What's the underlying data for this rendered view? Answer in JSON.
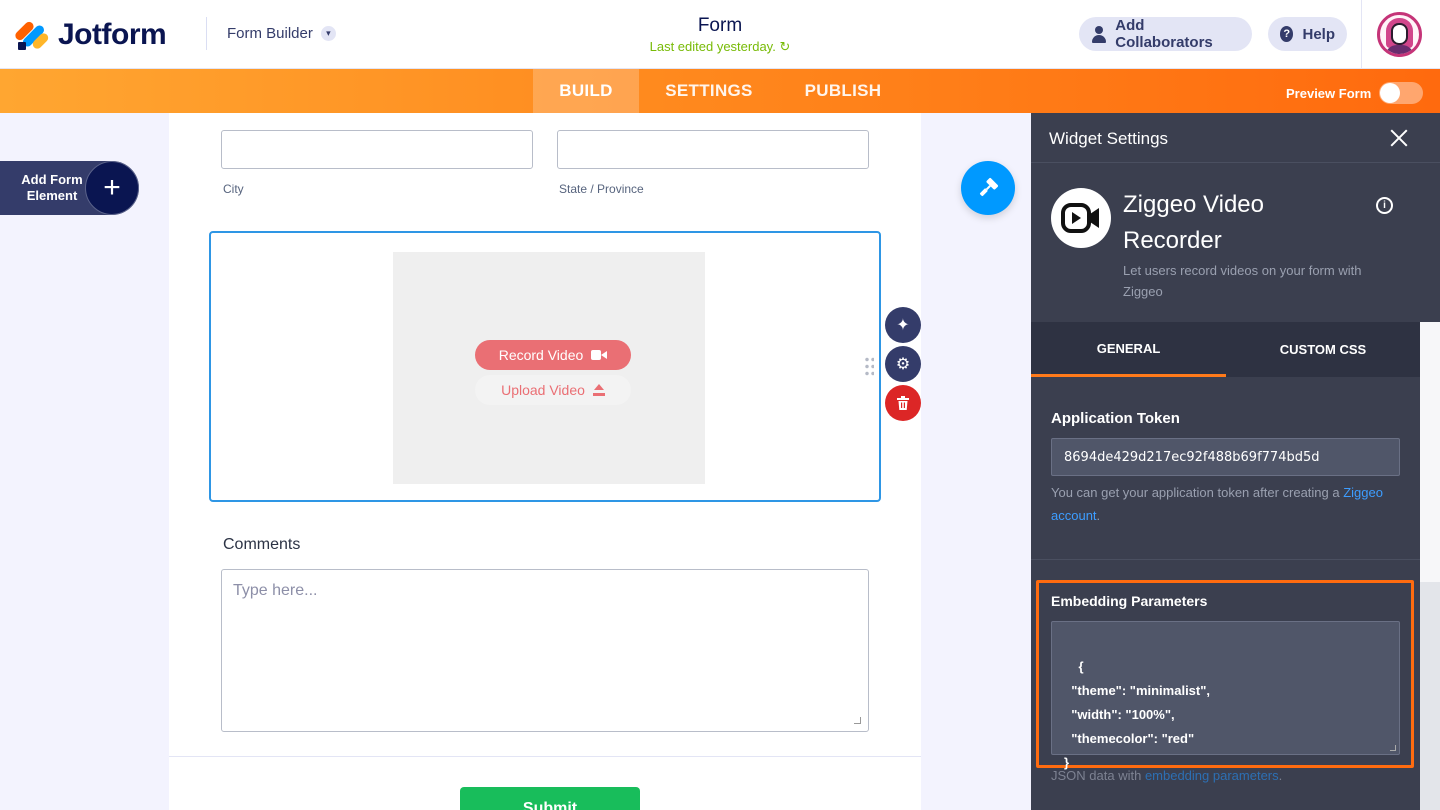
{
  "header": {
    "logo_text": "Jotform",
    "form_builder_label": "Form Builder",
    "form_title": "Form",
    "last_edited": "Last edited yesterday.",
    "add_collaborators_label": "Add Collaborators",
    "help_label": "Help"
  },
  "nav": {
    "tabs": [
      {
        "label": "BUILD",
        "active": true
      },
      {
        "label": "SETTINGS",
        "active": false
      },
      {
        "label": "PUBLISH",
        "active": false
      }
    ],
    "preview_label": "Preview Form",
    "preview_on": false
  },
  "sidebar": {
    "add_element_label": "Add Form Element"
  },
  "form": {
    "city_label": "City",
    "state_label": "State / Province",
    "record_button": "Record Video",
    "upload_button": "Upload Video",
    "comments_label": "Comments",
    "comments_placeholder": "Type here...",
    "submit_label": "Submit"
  },
  "panel": {
    "title": "Widget Settings",
    "widget_name": "Ziggeo Video Recorder",
    "widget_description": "Let users record videos on your form with Ziggeo",
    "tabs": [
      {
        "label": "GENERAL",
        "active": true
      },
      {
        "label": "CUSTOM CSS",
        "active": false
      }
    ],
    "app_token_label": "Application Token",
    "app_token_value": "8694de429d217ec92f488b69f774bd5d",
    "app_token_help_prefix": "You can get your application token after creating a ",
    "app_token_help_link": "Ziggeo account",
    "app_token_help_suffix": ".",
    "embed_label": "Embedding Parameters",
    "embed_value": "{\n  \"theme\": \"minimalist\",\n  \"width\": \"100%\",\n  \"themecolor\": \"red\"\n}",
    "json_note_prefix": "JSON data with ",
    "json_note_link": "embedding parameters",
    "json_note_suffix": "."
  },
  "colors": {
    "brand_orange": "#ff6100",
    "accent_blue": "#0099ff",
    "record_red": "#ea6f74",
    "submit_green": "#18bd5b",
    "panel_bg": "#3b3f4f",
    "highlight_orange": "#ff6b0f"
  }
}
